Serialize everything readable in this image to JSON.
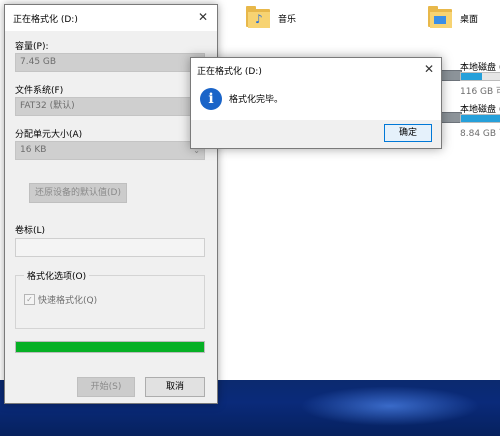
{
  "explorer": {
    "folders": [
      {
        "label": "音乐",
        "icon": "music-folder-icon"
      },
      {
        "label": "桌面",
        "icon": "desktop-folder-icon"
      }
    ],
    "drives": [
      {
        "label": "本地磁盘 (",
        "size": "116 GB 可",
        "usage": 0.35
      },
      {
        "label": "本地磁盘 (",
        "size": "8.84 GB 可",
        "usage": 0.78
      }
    ]
  },
  "format_dialog": {
    "title": "正在格式化 (D:)",
    "capacity_label": "容量(P):",
    "capacity_value": "7.45 GB",
    "filesystem_label": "文件系统(F)",
    "filesystem_value": "FAT32 (默认)",
    "allocation_label": "分配单元大小(A)",
    "allocation_value": "16 KB",
    "restore_defaults_label": "还原设备的默认值(D)",
    "volume_label_label": "卷标(L)",
    "volume_label_value": "",
    "options_group_label": "格式化选项(O)",
    "quick_format_label": "快速格式化(Q)",
    "quick_format_checked": true,
    "progress": 1.0,
    "start_label": "开始(S)",
    "cancel_label": "取消"
  },
  "message_box": {
    "title": "正在格式化 (D:)",
    "message": "格式化完毕。",
    "ok_label": "确定"
  },
  "colors": {
    "progress_green": "#06b025",
    "info_blue": "#1a64c8",
    "drive_bar_blue": "#26a0da"
  }
}
